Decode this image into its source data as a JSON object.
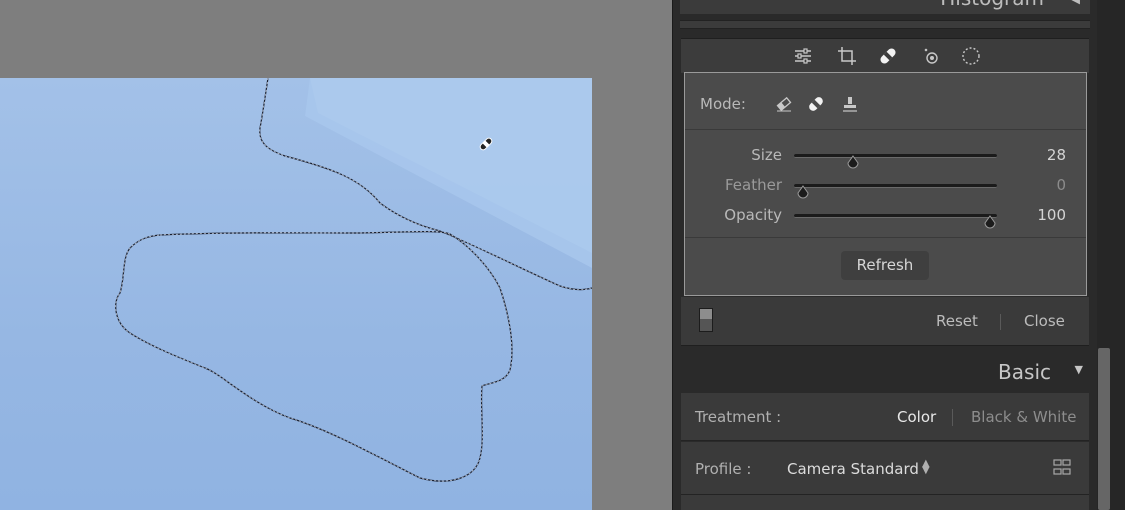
{
  "histogram": {
    "title": "Histogram"
  },
  "toolstrip": {
    "icons": [
      "sliders-icon",
      "crop-icon",
      "healing-icon",
      "red-eye-icon",
      "masking-icon"
    ]
  },
  "heal_panel": {
    "mode_label": "Mode:",
    "mode_icons": [
      "eraser-icon",
      "heal-icon",
      "clone-stamp-icon"
    ],
    "sliders": [
      {
        "label": "Size",
        "value": "28",
        "fraction": 0.29
      },
      {
        "label": "Feather",
        "value": "0",
        "fraction": 0.0
      },
      {
        "label": "Opacity",
        "value": "100",
        "fraction": 1.0
      }
    ],
    "refresh_label": "Refresh",
    "reset_label": "Reset",
    "close_label": "Close"
  },
  "basic": {
    "title": "Basic",
    "treatment_label": "Treatment :",
    "treatment_color": "Color",
    "treatment_bw": "Black & White",
    "profile_label": "Profile :",
    "profile_value": "Camera Standard"
  },
  "colors": {
    "panel_bg": "#2a2a2a",
    "photo_sky": "#96b7e3",
    "canvas_bg": "#7e7e7e"
  }
}
